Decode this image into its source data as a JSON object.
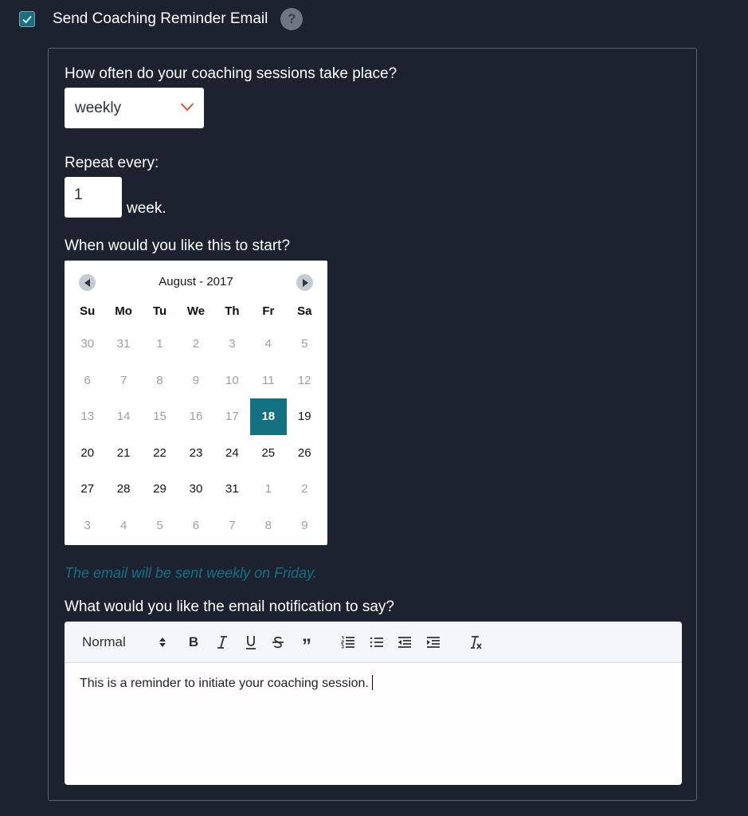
{
  "header": {
    "checkbox_checked": true,
    "label": "Send Coaching Reminder Email",
    "help_icon_text": "?"
  },
  "frequency": {
    "question": "How often do your coaching sessions take place?",
    "selected": "weekly"
  },
  "repeat": {
    "label": "Repeat every:",
    "value": "1",
    "unit": "week."
  },
  "start": {
    "question": "When would you like this to start?"
  },
  "calendar": {
    "title": "August - 2017",
    "weekdays": [
      "Su",
      "Mo",
      "Tu",
      "We",
      "Th",
      "Fr",
      "Sa"
    ],
    "selected_day": "18",
    "weeks": [
      [
        {
          "d": "30",
          "m": true
        },
        {
          "d": "31",
          "m": true
        },
        {
          "d": "1",
          "m": true
        },
        {
          "d": "2",
          "m": true
        },
        {
          "d": "3",
          "m": true
        },
        {
          "d": "4",
          "m": true
        },
        {
          "d": "5",
          "m": true
        }
      ],
      [
        {
          "d": "6",
          "m": true
        },
        {
          "d": "7",
          "m": true
        },
        {
          "d": "8",
          "m": true
        },
        {
          "d": "9",
          "m": true
        },
        {
          "d": "10",
          "m": true
        },
        {
          "d": "11",
          "m": true
        },
        {
          "d": "12",
          "m": true
        }
      ],
      [
        {
          "d": "13",
          "m": true
        },
        {
          "d": "14",
          "m": true
        },
        {
          "d": "15",
          "m": true
        },
        {
          "d": "16",
          "m": true
        },
        {
          "d": "17",
          "m": true
        },
        {
          "d": "18",
          "m": false,
          "s": true
        },
        {
          "d": "19",
          "m": false
        }
      ],
      [
        {
          "d": "20",
          "m": false
        },
        {
          "d": "21",
          "m": false
        },
        {
          "d": "22",
          "m": false
        },
        {
          "d": "23",
          "m": false
        },
        {
          "d": "24",
          "m": false
        },
        {
          "d": "25",
          "m": false
        },
        {
          "d": "26",
          "m": false
        }
      ],
      [
        {
          "d": "27",
          "m": false
        },
        {
          "d": "28",
          "m": false
        },
        {
          "d": "29",
          "m": false
        },
        {
          "d": "30",
          "m": false
        },
        {
          "d": "31",
          "m": false
        },
        {
          "d": "1",
          "m": true
        },
        {
          "d": "2",
          "m": true
        }
      ],
      [
        {
          "d": "3",
          "m": true
        },
        {
          "d": "4",
          "m": true
        },
        {
          "d": "5",
          "m": true
        },
        {
          "d": "6",
          "m": true
        },
        {
          "d": "7",
          "m": true
        },
        {
          "d": "8",
          "m": true
        },
        {
          "d": "9",
          "m": true
        }
      ]
    ]
  },
  "hint": "The email will be sent weekly on Friday.",
  "message": {
    "question": "What would you like the email notification to say?",
    "format": "Normal",
    "body": "This is a reminder to initiate your coaching session."
  },
  "colors": {
    "accent": "#137181",
    "background": "#1d2230",
    "chevron": "#e4513c"
  }
}
